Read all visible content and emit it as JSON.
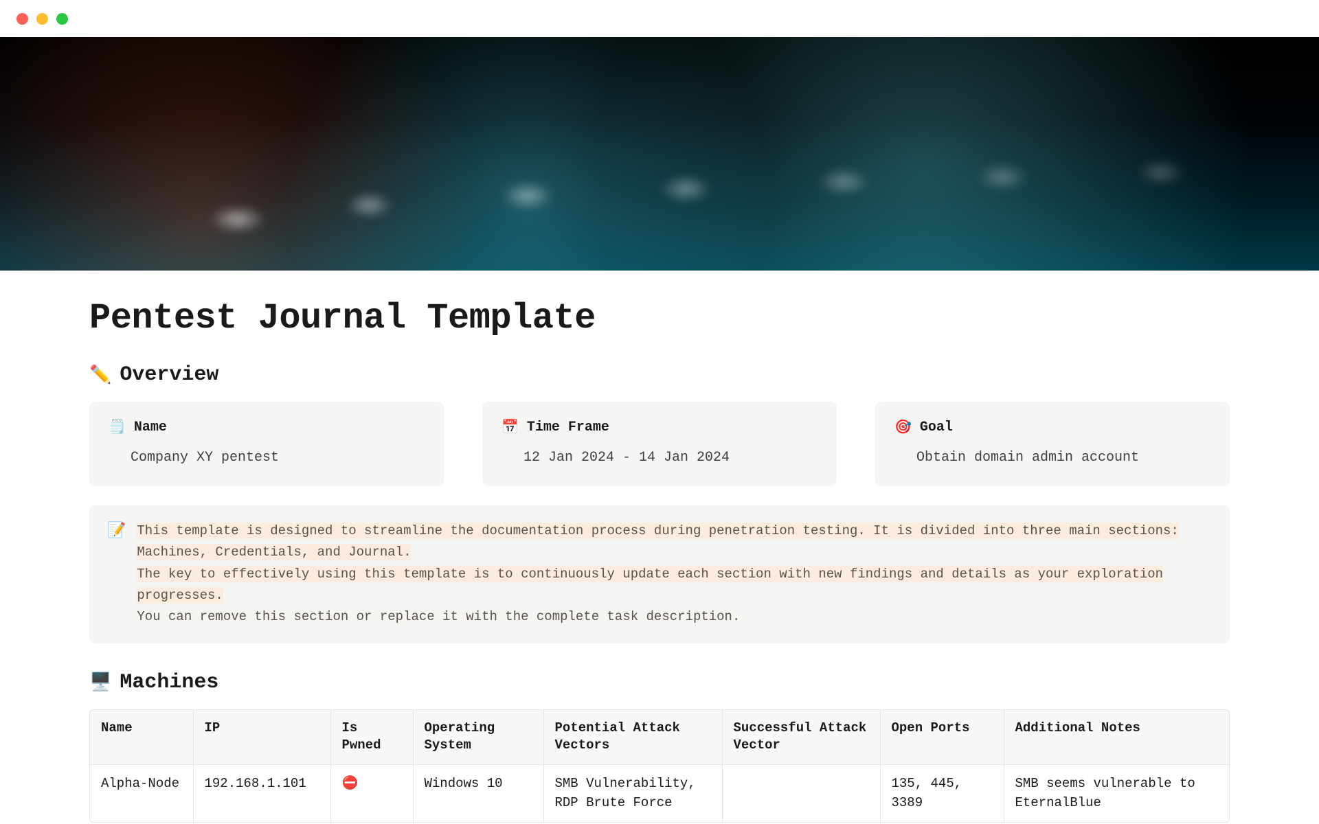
{
  "page": {
    "title": "Pentest Journal Template"
  },
  "overview": {
    "heading_emoji": "✏️",
    "heading": "Overview",
    "cards": [
      {
        "emoji": "🗒️",
        "label": "Name",
        "value": "Company XY pentest"
      },
      {
        "emoji": "📅",
        "label": "Time Frame",
        "value": "12 Jan 2024 - 14 Jan 2024"
      },
      {
        "emoji": "🎯",
        "label": "Goal",
        "value": "Obtain domain admin account"
      }
    ],
    "callout": {
      "emoji": "📝",
      "line1": "This template is designed to streamline the documentation process during penetration testing. It is divided into three main sections: Machines, Credentials, and Journal.",
      "line2": "The key to effectively using this template is to continuously update each section with new findings and details as your exploration progresses.",
      "line3": "You can remove this section or replace it with the complete task description."
    }
  },
  "machines": {
    "heading_emoji": "🖥️",
    "heading": "Machines",
    "columns": [
      "Name",
      "IP",
      "Is Pwned",
      "Operating System",
      "Potential Attack Vectors",
      "Successful Attack Vector",
      "Open Ports",
      "Additional Notes"
    ],
    "rows": [
      {
        "name": "Alpha-Node",
        "ip": "192.168.1.101",
        "is_pwned": "⛔",
        "os": "Windows 10",
        "potential": "SMB Vulnerability, RDP Brute Force",
        "successful": "",
        "ports": "135, 445, 3389",
        "notes": "SMB seems vulnerable to EternalBlue"
      }
    ]
  }
}
